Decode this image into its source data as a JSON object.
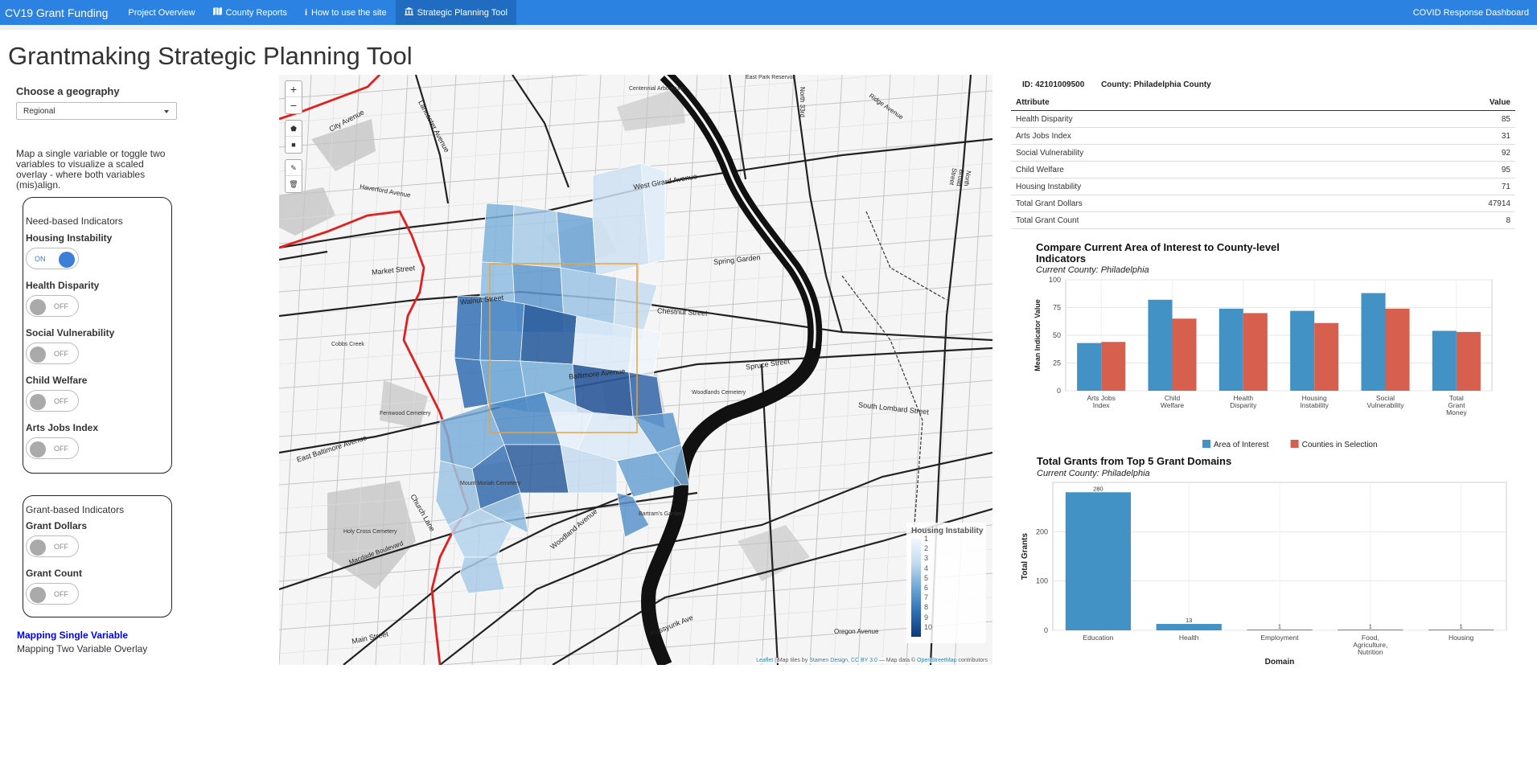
{
  "nav": {
    "brand": "CV19 Grant Funding",
    "items": [
      {
        "label": "Project Overview",
        "icon": ""
      },
      {
        "label": "County Reports",
        "icon": "map-icon"
      },
      {
        "label": "How to use the site",
        "icon": "info-icon"
      },
      {
        "label": "Strategic Planning Tool",
        "icon": "bank-icon"
      }
    ],
    "right": "COVID Response Dashboard"
  },
  "page": {
    "title": "Grantmaking Strategic Planning Tool"
  },
  "sidebar": {
    "geo_label": "Choose a geography",
    "geo_value": "Regional",
    "help": "Map a single variable or toggle two variables to visualize a scaled overlay - where both variables (mis)align.",
    "need_title": "Need-based Indicators",
    "need_toggles": [
      {
        "label": "Housing Instability",
        "state": "ON"
      },
      {
        "label": "Health Disparity",
        "state": "OFF"
      },
      {
        "label": "Social Vulnerability",
        "state": "OFF"
      },
      {
        "label": "Child Welfare",
        "state": "OFF"
      },
      {
        "label": "Arts Jobs Index",
        "state": "OFF"
      }
    ],
    "grant_title": "Grant-based Indicators",
    "grant_toggles": [
      {
        "label": "Grant Dollars",
        "state": "OFF"
      },
      {
        "label": "Grant Count",
        "state": "OFF"
      }
    ],
    "mode_single": "Mapping Single Variable",
    "mode_two": "Mapping Two Variable Overlay"
  },
  "map": {
    "zoom_in": "+",
    "zoom_out": "−",
    "legend_title": "Housing Instability",
    "legend_ticks": [
      "1",
      "2",
      "3",
      "4",
      "5",
      "6",
      "7",
      "8",
      "9",
      "10"
    ],
    "attribution": {
      "leaflet": "Leaflet",
      "tiles_prefix": "| Map tiles by",
      "stamen": "Stamen Design",
      "cc": "CC BY 3.0",
      "data_prefix": "— Map data ©",
      "osm": "OpenStreetMap",
      "suffix": "contributors"
    },
    "street_labels": [
      "Lancaster Avenue",
      "City Avenue",
      "West Girard Avenue",
      "Market Street",
      "Walnut Street",
      "Baltimore Avenue",
      "Chestnut Street",
      "Spruce Street",
      "South Lombard Street",
      "Woodland Avenue",
      "Passyunk Ave",
      "Main Street",
      "Church Lane",
      "East Baltimore Avenue",
      "Haverford Avenue",
      "Spring Garden",
      "North 33rd",
      "Ridge Avenue",
      "North Broad Street",
      "Cobbs Creek",
      "Mount Moriah Cemetery",
      "Holy Cross Cemetery",
      "Fernwood Cemetery",
      "Woodlands Cemetery",
      "Bartram's Garden",
      "Centennial Arboretum",
      "East Park Reservoir",
      "Macdade Boulevard",
      "Oregon Avenue"
    ],
    "colors": {
      "water": "#111111",
      "park": "#cfcfcf",
      "boundary": "#e0201e",
      "selection": "#e9a33c"
    }
  },
  "info": {
    "id_label": "ID: 42101009500",
    "county_label": "County: Philadelphia County",
    "columns": [
      "Attribute",
      "Value"
    ],
    "rows": [
      {
        "attr": "Health Disparity",
        "value": "85"
      },
      {
        "attr": "Arts Jobs Index",
        "value": "31"
      },
      {
        "attr": "Social Vulnerability",
        "value": "92"
      },
      {
        "attr": "Child Welfare",
        "value": "95"
      },
      {
        "attr": "Housing Instability",
        "value": "71"
      },
      {
        "attr": "Total Grant Dollars",
        "value": "47914"
      },
      {
        "attr": "Total Grant Count",
        "value": "8"
      }
    ]
  },
  "chart_data": [
    {
      "type": "bar",
      "title": "Compare Current Area of Interest to County-level Indicators",
      "subtitle": "Current County: Philadelphia",
      "categories": [
        [
          "Arts Jobs",
          "Index"
        ],
        [
          "Child",
          "Welfare"
        ],
        [
          "Health",
          "Disparity"
        ],
        [
          "Housing",
          "Instability"
        ],
        [
          "Social",
          "Vulnerability"
        ],
        [
          "Total",
          "Grant",
          "Money"
        ]
      ],
      "series": [
        {
          "name": "Area of Interest",
          "color": "#4292c6",
          "values": [
            43,
            82,
            74,
            72,
            88,
            54
          ]
        },
        {
          "name": "Counties in Selection",
          "color": "#d6604d",
          "values": [
            44,
            65,
            70,
            61,
            74,
            53
          ]
        }
      ],
      "xlabel": "",
      "ylabel": "Mean Indicator Value",
      "ylim": [
        0,
        100
      ],
      "yticks": [
        0,
        25,
        50,
        75,
        100
      ],
      "legend": "bottom"
    },
    {
      "type": "bar",
      "title": "Total Grants from Top 5 Grant Domains",
      "subtitle": "Current County: Philadelphia",
      "categories": [
        [
          "Education"
        ],
        [
          "Health"
        ],
        [
          "Employment"
        ],
        [
          "Food,",
          "Agriculture,",
          "Nutrition"
        ],
        [
          "Housing"
        ]
      ],
      "values": [
        280,
        13,
        1,
        1,
        1
      ],
      "data_labels": [
        "280",
        "13",
        "1",
        "1",
        "1"
      ],
      "color": "#4292c6",
      "xlabel": "Domain",
      "ylabel": "Total Grants",
      "ylim": [
        0,
        300
      ],
      "yticks": [
        0,
        100,
        200
      ]
    }
  ]
}
